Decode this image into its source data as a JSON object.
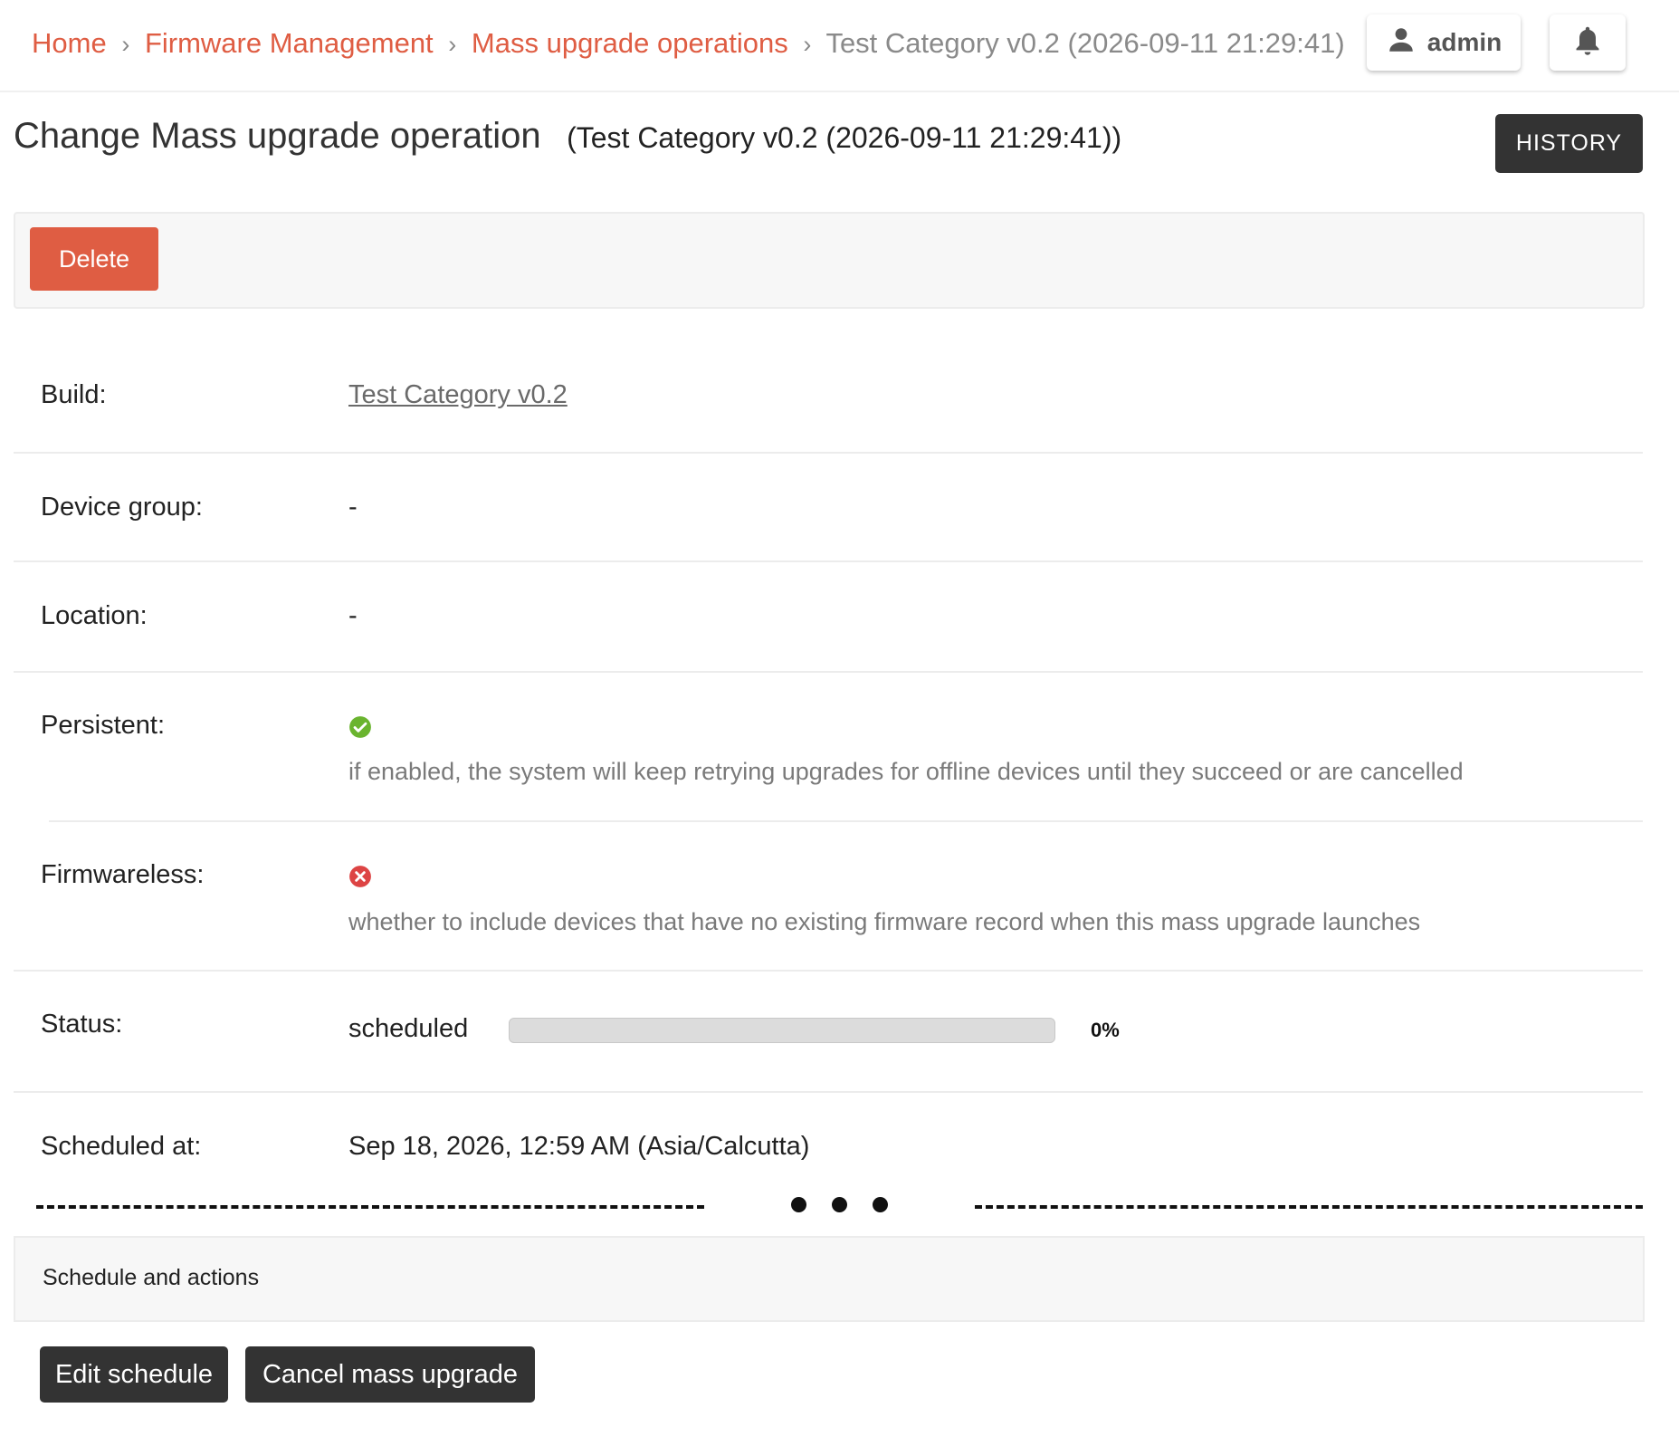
{
  "breadcrumb": {
    "home": "Home",
    "firmware": "Firmware Management",
    "operations": "Mass upgrade operations",
    "current": "Test Category v0.2 (2026-09-11 21:29:41)",
    "separator": "›"
  },
  "user": {
    "name": "admin",
    "icon": "user-icon"
  },
  "notifications": {
    "icon": "bell-icon"
  },
  "page": {
    "title": "Change Mass upgrade operation",
    "subtitle": "(Test Category v0.2 (2026-09-11 21:29:41))",
    "history_label": "HISTORY"
  },
  "actions": {
    "delete_label": "Delete"
  },
  "fields": {
    "build": {
      "label": "Build:",
      "value": "Test Category v0.2"
    },
    "device_group": {
      "label": "Device group:",
      "value": "-"
    },
    "location": {
      "label": "Location:",
      "value": "-"
    },
    "persistent": {
      "label": "Persistent:",
      "value": true,
      "icon": "check-circle-icon",
      "help": "if enabled, the system will keep retrying upgrades for offline devices until they succeed or are cancelled"
    },
    "firmwareless": {
      "label": "Firmwareless:",
      "value": false,
      "icon": "x-circle-icon",
      "help": "whether to include devices that have no existing firmware record when this mass upgrade launches"
    },
    "status": {
      "label": "Status:",
      "value": "scheduled",
      "progress_percent": 0,
      "progress_text": "0%"
    },
    "scheduled_at": {
      "label": "Scheduled at:",
      "value": "Sep 18, 2026, 12:59 AM (Asia/Calcutta)"
    }
  },
  "schedule_module": {
    "title": "Schedule and actions",
    "edit_label": "Edit schedule",
    "cancel_label": "Cancel mass upgrade"
  },
  "colors": {
    "accent": "#df5d43",
    "dark_button": "#333333",
    "success": "#6ab42f",
    "danger": "#dd4444"
  }
}
